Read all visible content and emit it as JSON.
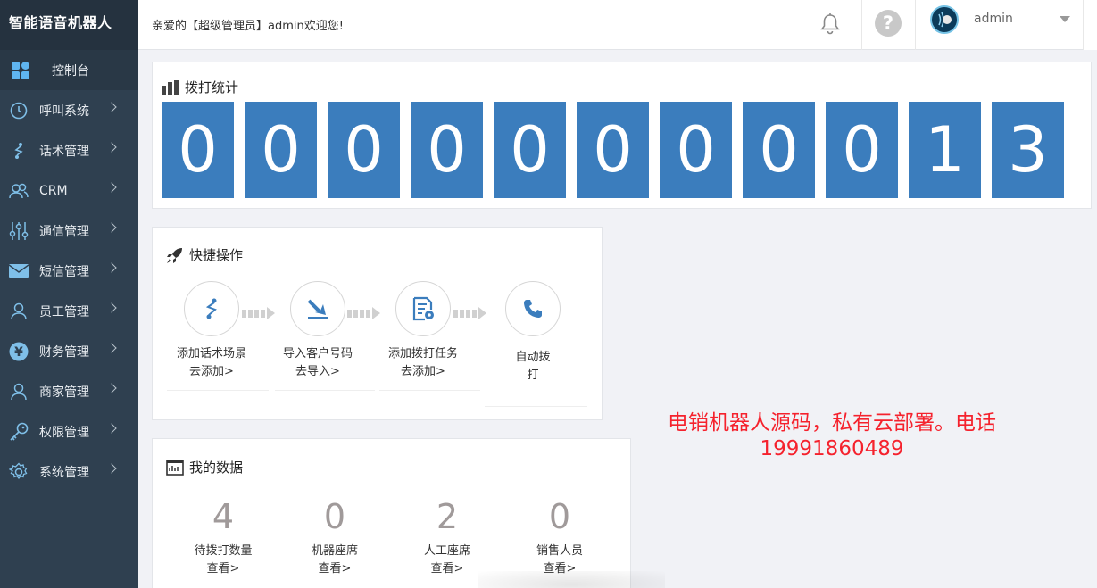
{
  "app": {
    "logo_text": "智能语音机器人"
  },
  "header": {
    "welcome_text": "亲爱的【超级管理员】admin欢迎您!",
    "help_symbol": "?",
    "username": "admin"
  },
  "sidebar": {
    "items": [
      {
        "label": "控制台",
        "icon": "dashboard-icon"
      },
      {
        "label": "呼叫系统",
        "icon": "clock-icon"
      },
      {
        "label": "话术管理",
        "icon": "flow-icon"
      },
      {
        "label": "CRM",
        "icon": "users-icon"
      },
      {
        "label": "通信管理",
        "icon": "sliders-icon"
      },
      {
        "label": "短信管理",
        "icon": "envelope-icon"
      },
      {
        "label": "员工管理",
        "icon": "user-icon"
      },
      {
        "label": "财务管理",
        "icon": "yuan-icon"
      },
      {
        "label": "商家管理",
        "icon": "user-icon"
      },
      {
        "label": "权限管理",
        "icon": "key-icon"
      },
      {
        "label": "系统管理",
        "icon": "gear-icon"
      }
    ]
  },
  "dial_stats": {
    "title": "拨打统计",
    "digits": [
      "0",
      "0",
      "0",
      "0",
      "0",
      "0",
      "0",
      "0",
      "0",
      "1",
      "3"
    ]
  },
  "quick_ops": {
    "title": "快捷操作",
    "items": [
      {
        "label": "添加话术场景",
        "action": "去添加>",
        "icon": "flow-icon"
      },
      {
        "label": "导入客户号码",
        "action": "去导入>",
        "icon": "import-icon"
      },
      {
        "label": "添加拨打任务",
        "action": "去添加>",
        "icon": "task-settings-icon"
      },
      {
        "label": "自动拨",
        "action": "打",
        "icon": "phone-icon"
      }
    ]
  },
  "my_data": {
    "title": "我的数据",
    "stats": [
      {
        "value": "4",
        "label": "待拨打数量",
        "link": "查看>"
      },
      {
        "value": "0",
        "label": "机器座席",
        "link": "查看>"
      },
      {
        "value": "2",
        "label": "人工座席",
        "link": "查看>"
      },
      {
        "value": "0",
        "label": "销售人员",
        "link": "查看>"
      }
    ]
  },
  "promo": {
    "line1": "电销机器人源码，私有云部署。电话",
    "line2": "19991860489"
  },
  "colors": {
    "sidebar_bg": "#2f4050",
    "digit_bg": "#3b7dbd",
    "promo_text": "#f5222d",
    "icon_blue": "#3b7dbd"
  }
}
